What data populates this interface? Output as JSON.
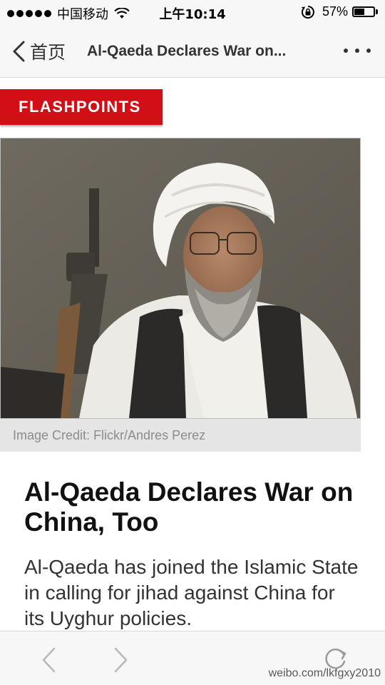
{
  "status_bar": {
    "carrier": "中国移动",
    "time": "上午10:14",
    "battery_percent": "57%",
    "battery_level": 0.57,
    "icons": [
      "signal-dots-icon",
      "wifi-icon",
      "rotation-lock-icon",
      "battery-icon"
    ]
  },
  "nav": {
    "back_label": "首页",
    "title": "Al-Qaeda Declares War on...",
    "more_icon": "more-dots-icon"
  },
  "article": {
    "section_tag": "FLASHPOINTS",
    "image_credit": "Image Credit: Flickr/Andres Perez",
    "headline": "Al-Qaeda Declares War on China, Too",
    "dek": "Al-Qaeda has joined the Islamic State in calling for jihad against China for its Uyghur policies."
  },
  "toolbar": {
    "icons": [
      "back-chevron-icon",
      "forward-chevron-icon",
      "reload-icon"
    ]
  },
  "watermark": {
    "text": "weibo.com/lkfgxy2010"
  },
  "colors": {
    "accent_red": "#d20f17",
    "bar_bg": "#f7f7f7",
    "credit_bg": "#e5e5e5"
  }
}
